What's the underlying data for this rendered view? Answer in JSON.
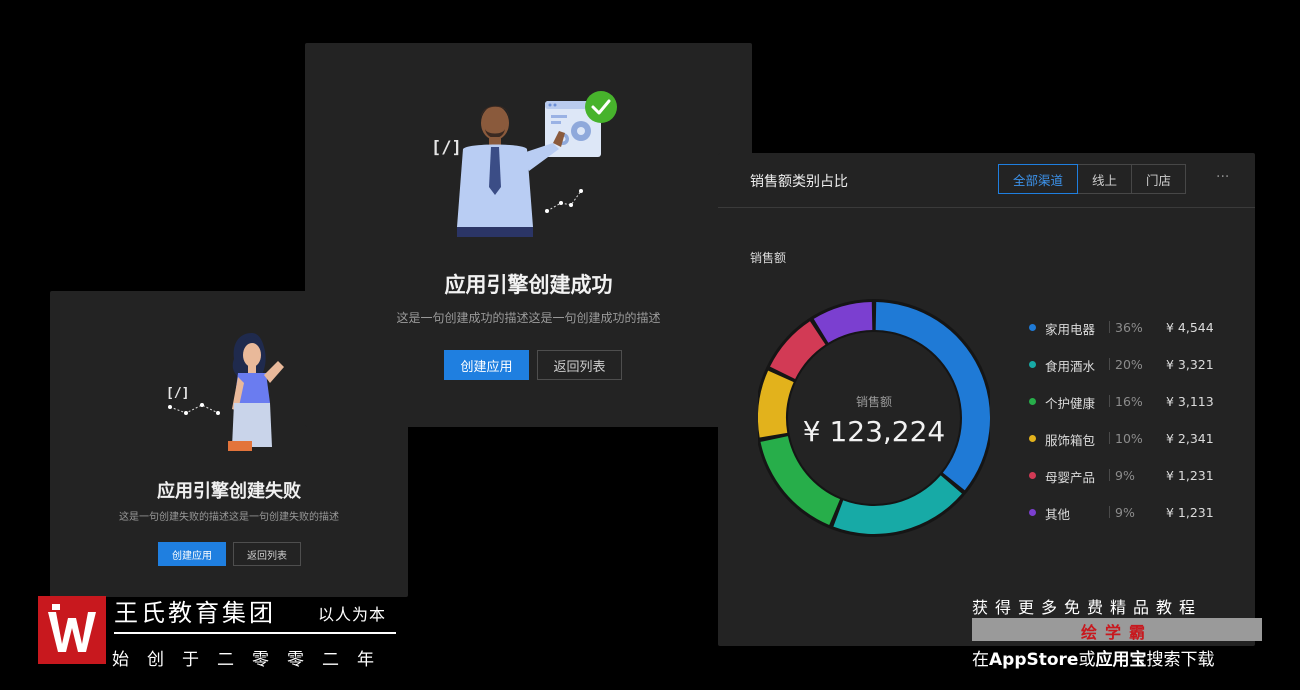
{
  "success_card": {
    "title": "应用引擎创建成功",
    "description": "这是一句创建成功的描述这是一句创建成功的描述",
    "primary_button": "创建应用",
    "secondary_button": "返回列表",
    "code_glyph": "[/]"
  },
  "fail_card": {
    "title": "应用引擎创建失败",
    "description": "这是一句创建失败的描述这是一句创建失败的描述",
    "primary_button": "创建应用",
    "secondary_button": "返回列表",
    "code_glyph": "[/]"
  },
  "sales_card": {
    "title": "销售额类别占比",
    "tabs": [
      "全部渠道",
      "线上",
      "门店"
    ],
    "active_tab": "全部渠道",
    "more": "···",
    "subtitle": "销售额",
    "center_label": "销售额",
    "center_value": "¥ 123,224",
    "legend": [
      {
        "name": "家用电器",
        "percent": "36%",
        "value": "¥ 4,544",
        "color": "#1f7ad6"
      },
      {
        "name": "食用酒水",
        "percent": "20%",
        "value": "¥ 3,321",
        "color": "#17aaa6"
      },
      {
        "name": "个护健康",
        "percent": "16%",
        "value": "¥ 3,113",
        "color": "#27ae4a"
      },
      {
        "name": "服饰箱包",
        "percent": "10%",
        "value": "¥ 2,341",
        "color": "#e2b21c"
      },
      {
        "name": "母婴产品",
        "percent": "9%",
        "value": "¥ 1,231",
        "color": "#d23a55"
      },
      {
        "name": "其他",
        "percent": "9%",
        "value": "¥ 1,231",
        "color": "#7b3fd0"
      }
    ]
  },
  "branding": {
    "name": "王氏教育集团",
    "slogan": "以人为本",
    "since": "始创于二零零二年",
    "promo_line1": "获得更多免费精品教程",
    "promo_line2": "绘学霸",
    "promo_line3_a": "在",
    "promo_line3_b": "AppStore",
    "promo_line3_c": "或",
    "promo_line3_d": "应用宝",
    "promo_line3_e": "搜索下载"
  }
}
